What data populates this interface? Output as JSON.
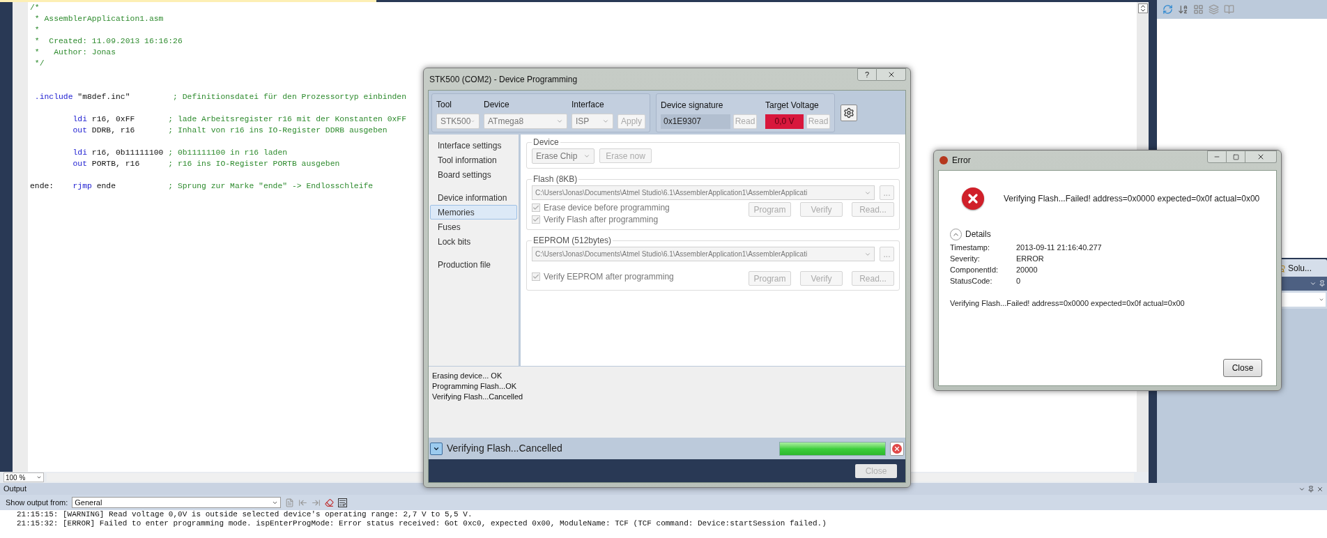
{
  "editor": {
    "blocks": [
      [
        {
          "kind": "comment",
          "tokens": [
            {
              "kind": "comment",
              "text": "/*"
            }
          ]
        },
        {
          "kind": "comment",
          "tokens": [
            {
              "kind": "comment",
              "text": " * AssemblerApplication1.asm"
            }
          ]
        },
        {
          "kind": "comment",
          "tokens": [
            {
              "kind": "comment",
              "text": " *"
            }
          ]
        },
        {
          "kind": "comment",
          "tokens": [
            {
              "kind": "comment",
              "text": " *  Created: 11.09.2013 16:16:26"
            }
          ]
        },
        {
          "kind": "comment",
          "tokens": [
            {
              "kind": "comment",
              "text": " *   Author: Jonas"
            }
          ]
        },
        {
          "kind": "comment",
          "tokens": [
            {
              "kind": "comment",
              "text": " */"
            }
          ]
        }
      ],
      [
        {
          "kind": "directive",
          "tokens": [
            {
              "kind": "keyword",
              "text": ".include"
            },
            {
              "kind": "plain",
              "text": "\"m8def.inc\""
            },
            {
              "kind": "comment",
              "text": "; Definitionsdatei für den Prozessortyp einbinden"
            }
          ]
        }
      ],
      [
        {
          "kind": "instruction",
          "tokens": [
            {
              "kind": "keyword",
              "text": "ldi"
            },
            {
              "kind": "plain",
              "text": "r16, 0xFF"
            },
            {
              "kind": "comment",
              "text": "; lade Arbeitsregister r16 mit der Konstanten 0xFF"
            }
          ]
        },
        {
          "kind": "instruction",
          "tokens": [
            {
              "kind": "keyword",
              "text": "out"
            },
            {
              "kind": "plain",
              "text": "DDRB, r16"
            },
            {
              "kind": "comment",
              "text": "; Inhalt von r16 ins IO-Register DDRB ausgeben"
            }
          ]
        }
      ],
      [
        {
          "kind": "instruction",
          "tokens": [
            {
              "kind": "keyword",
              "text": "ldi"
            },
            {
              "kind": "plain",
              "text": "r16, 0b11111100"
            },
            {
              "kind": "comment",
              "text": "; 0b11111100 in r16 laden"
            }
          ]
        },
        {
          "kind": "instruction",
          "tokens": [
            {
              "kind": "keyword",
              "text": "out"
            },
            {
              "kind": "plain",
              "text": "PORTB, r16"
            },
            {
              "kind": "comment",
              "text": "; r16 ins IO-Register PORTB ausgeben"
            }
          ]
        }
      ],
      [
        {
          "kind": "label",
          "tokens": [
            {
              "kind": "plain",
              "text": "ende:"
            },
            {
              "kind": "keyword",
              "text": "rjmp"
            },
            {
              "kind": "plain",
              "text": "ende"
            },
            {
              "kind": "comment",
              "text": "; Sprung zur Marke \"ende\" -> Endlosschleife"
            }
          ]
        }
      ]
    ],
    "zoom": "100 %"
  },
  "solution_explorer": {
    "tab": "Solu..."
  },
  "output": {
    "title": "Output",
    "source_label": "Show output from:",
    "source": "General",
    "lines": [
      "21:15:15: [WARNING] Read voltage 0,0V is outside selected device's operating range: 2,7 V to 5,5 V.",
      "21:15:32: [ERROR] Failed to enter programming mode. ispEnterProgMode: Error status received: Got 0xc0, expected 0x00, ModuleName: TCF (TCF command: Device:startSession failed.)"
    ]
  },
  "programming_dialog": {
    "title": "STK500 (COM2) - Device Programming",
    "help_button": "?",
    "tool": {
      "label": "Tool",
      "value": "STK500"
    },
    "device": {
      "label": "Device",
      "value": "ATmega8"
    },
    "interface": {
      "label": "Interface",
      "value": "ISP"
    },
    "apply": "Apply",
    "signature": {
      "label": "Device signature",
      "value": "0x1E9307",
      "read": "Read"
    },
    "voltage": {
      "label": "Target Voltage",
      "value": "0,0 V",
      "read": "Read",
      "alarm": true
    },
    "nav_groups": [
      [
        {
          "label": "Interface settings",
          "selected": false
        },
        {
          "label": "Tool information",
          "selected": false
        },
        {
          "label": "Board settings",
          "selected": false
        }
      ],
      [
        {
          "label": "Device information",
          "selected": false
        },
        {
          "label": "Memories",
          "selected": true
        },
        {
          "label": "Fuses",
          "selected": false
        },
        {
          "label": "Lock bits",
          "selected": false
        }
      ],
      [
        {
          "label": "Production file",
          "selected": false
        }
      ]
    ],
    "device_section": {
      "legend": "Device",
      "mode": "Erase Chip",
      "erase": "Erase now"
    },
    "memories": [
      {
        "legend": "Flash (8KB)",
        "path": "C:\\Users\\Jonas\\Documents\\Atmel Studio\\6.1\\AssemblerApplication1\\AssemblerApplicati",
        "browse": "...",
        "options": [
          {
            "label": "Erase device before programming",
            "checked": true,
            "disabled": true
          },
          {
            "label": "Verify Flash after programming",
            "checked": true,
            "disabled": true
          }
        ],
        "buttons": [
          {
            "label": "Program",
            "disabled": true
          },
          {
            "label": "Verify",
            "disabled": true
          },
          {
            "label": "Read...",
            "disabled": true
          }
        ]
      },
      {
        "legend": "EEPROM (512bytes)",
        "path": "C:\\Users\\Jonas\\Documents\\Atmel Studio\\6.1\\AssemblerApplication1\\AssemblerApplicati",
        "browse": "...",
        "options": [
          {
            "label": "Verify EEPROM after programming",
            "checked": true,
            "disabled": true
          }
        ],
        "buttons": [
          {
            "label": "Program",
            "disabled": true
          },
          {
            "label": "Verify",
            "disabled": true
          },
          {
            "label": "Read...",
            "disabled": true
          }
        ]
      }
    ],
    "log": [
      "Erasing device... OK",
      "Programming Flash...OK",
      "Verifying Flash...Cancelled"
    ],
    "status": {
      "text": "Verifying Flash...Cancelled",
      "level": 1.0
    },
    "close": {
      "label": "Close",
      "disabled": true
    }
  },
  "error_dialog": {
    "title": "Error",
    "message": "Verifying Flash...Failed! address=0x0000 expected=0x0f actual=0x00",
    "details_label": "Details",
    "expanded": true,
    "details": [
      {
        "key": "Timestamp:",
        "value": "2013-09-11 21:16:40.277"
      },
      {
        "key": "Severity:",
        "value": "ERROR"
      },
      {
        "key": "ComponentId:",
        "value": "20000"
      },
      {
        "key": "StatusCode:",
        "value": "0"
      }
    ],
    "detail_message": "Verifying Flash...Failed! address=0x0000 expected=0x0f actual=0x00",
    "close": "Close"
  }
}
